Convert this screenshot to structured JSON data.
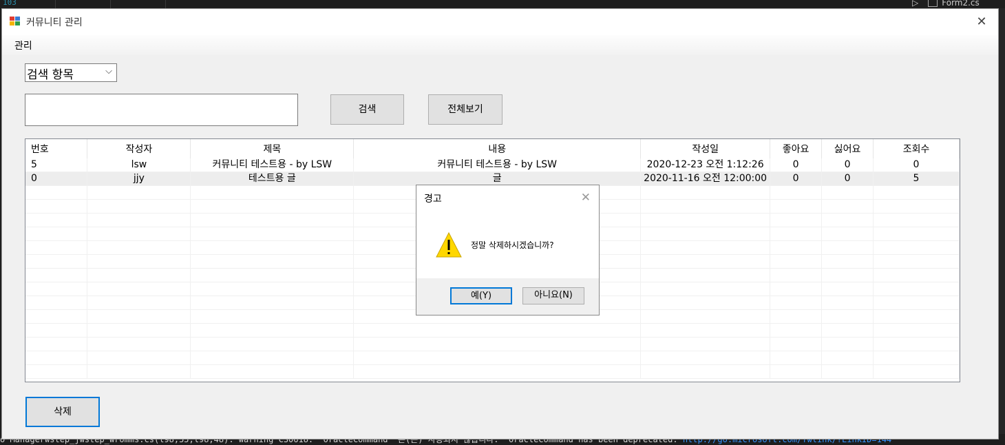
{
  "ide": {
    "top_number": "103",
    "tree_item": "Form2.cs",
    "output_line": "o Managerwstep_jwstep_wromms.cs(l98,55,l98,48): warning CS0618: 'OracleCommand' 은(는) 사용되지 않습니다. 'OracleCommand has been deprecated.",
    "output_link": "http://go.microsoft.com/fwlink/?LinkID=144"
  },
  "window": {
    "title": "커뮤니티 관리",
    "close_glyph": "✕"
  },
  "menu": {
    "items": [
      "관리"
    ]
  },
  "search": {
    "field_combo": "검색 항목",
    "combo_arrow": "⌵",
    "input_value": "",
    "search_button": "검색",
    "view_all_button": "전체보기"
  },
  "grid": {
    "columns": [
      "번호",
      "작성자",
      "제목",
      "내용",
      "작성일",
      "좋아요",
      "싫어요",
      "조회수"
    ],
    "rows": [
      [
        "5",
        "lsw",
        "커뮤니티 테스트용 - by LSW",
        "커뮤니티 테스트용 - by LSW",
        "2020-12-23 오전 1:12:26",
        "0",
        "0",
        "0"
      ],
      [
        "0",
        "jjy",
        "테스트용 글",
        "글",
        "2020-11-16 오전 12:00:00",
        "0",
        "0",
        "5"
      ]
    ]
  },
  "delete_button": "삭제",
  "dialog": {
    "title": "경고",
    "close_glyph": "✕",
    "message": "정말 삭제하시겠습니까?",
    "yes_button": "예(Y)",
    "no_button": "아니요(N)"
  },
  "colors": {
    "focus_border": "#0078d7",
    "warning_yellow": "#ffd700",
    "window_bg": "#f0f0f0"
  }
}
